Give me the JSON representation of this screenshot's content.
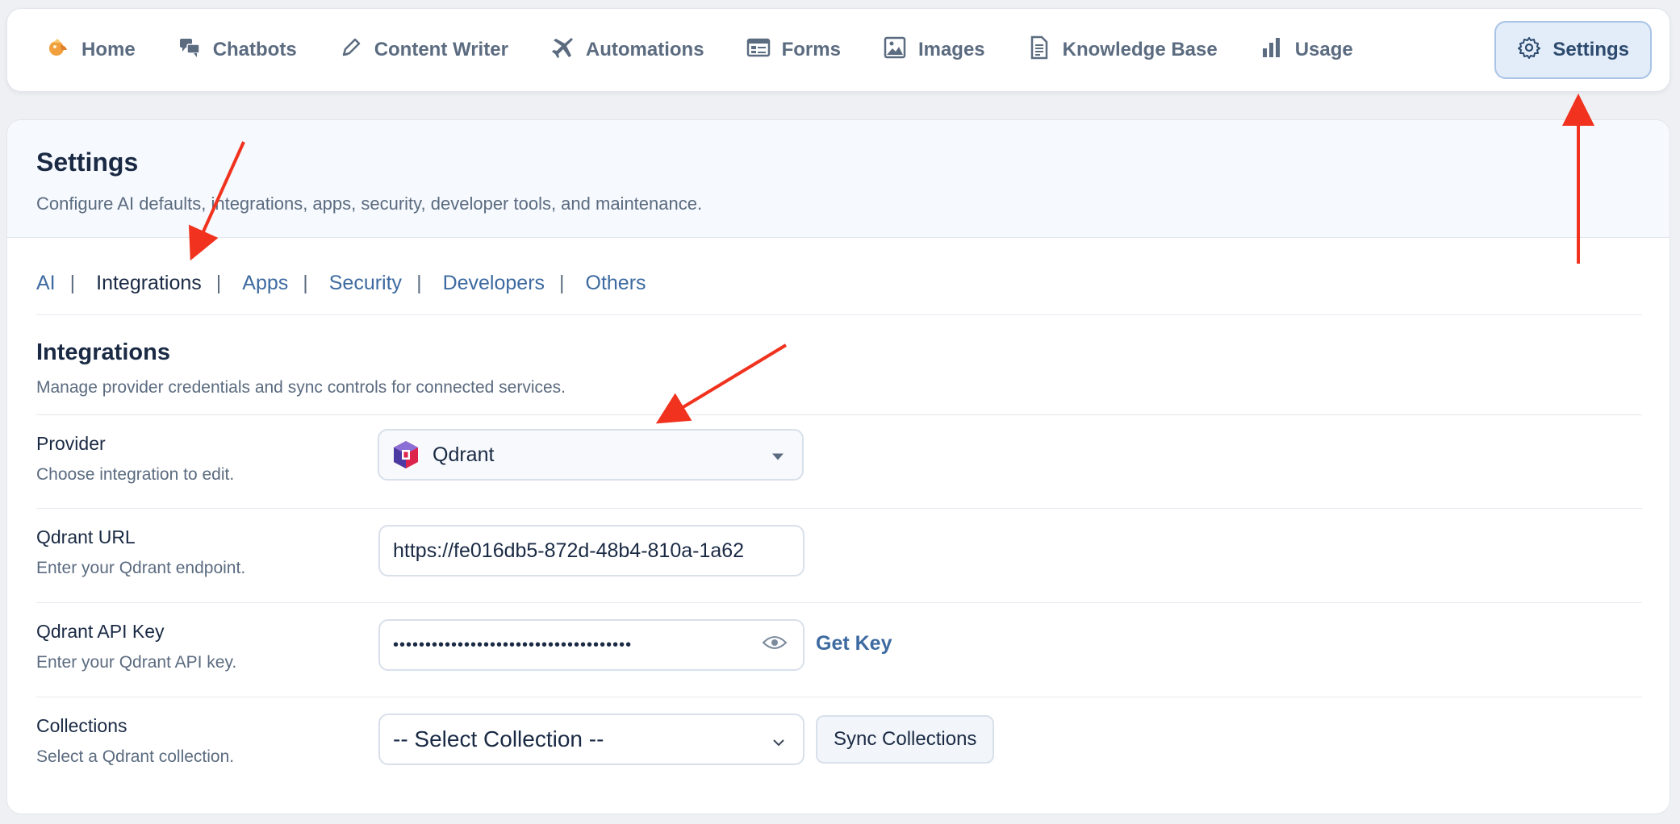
{
  "nav": {
    "items": [
      {
        "label": "Home",
        "icon": "home-icon"
      },
      {
        "label": "Chatbots",
        "icon": "chat-bubbles-icon"
      },
      {
        "label": "Content Writer",
        "icon": "pencil-icon"
      },
      {
        "label": "Automations",
        "icon": "airplane-icon"
      },
      {
        "label": "Forms",
        "icon": "form-icon"
      },
      {
        "label": "Images",
        "icon": "image-icon"
      },
      {
        "label": "Knowledge Base",
        "icon": "document-icon"
      },
      {
        "label": "Usage",
        "icon": "bar-chart-icon"
      }
    ],
    "active": {
      "label": "Settings",
      "icon": "gear-icon"
    }
  },
  "header": {
    "title": "Settings",
    "subtitle": "Configure AI defaults, integrations, apps, security, developer tools, and maintenance."
  },
  "tabs": [
    {
      "label": "AI"
    },
    {
      "label": "Integrations",
      "active": true
    },
    {
      "label": "Apps"
    },
    {
      "label": "Security"
    },
    {
      "label": "Developers"
    },
    {
      "label": "Others"
    }
  ],
  "tab_separator": "|",
  "section": {
    "title": "Integrations",
    "subtitle": "Manage provider credentials and sync controls for connected services."
  },
  "form": {
    "provider": {
      "label": "Provider",
      "hint": "Choose integration to edit.",
      "value": "Qdrant"
    },
    "url": {
      "label": "Qdrant URL",
      "hint": "Enter your Qdrant endpoint.",
      "value": "https://fe016db5-872d-48b4-810a-1a62"
    },
    "api_key": {
      "label": "Qdrant API Key",
      "hint": "Enter your Qdrant API key.",
      "value": "•••••••••••••••••••••••••••••••••••••",
      "get_key_label": "Get Key"
    },
    "collections": {
      "label": "Collections",
      "hint": "Select a Qdrant collection.",
      "value": "-- Select Collection --",
      "sync_label": "Sync Collections"
    }
  },
  "colors": {
    "accent": "#3d6aa0",
    "arrow": "#f0321e",
    "active_bg": "#e3edf9"
  }
}
